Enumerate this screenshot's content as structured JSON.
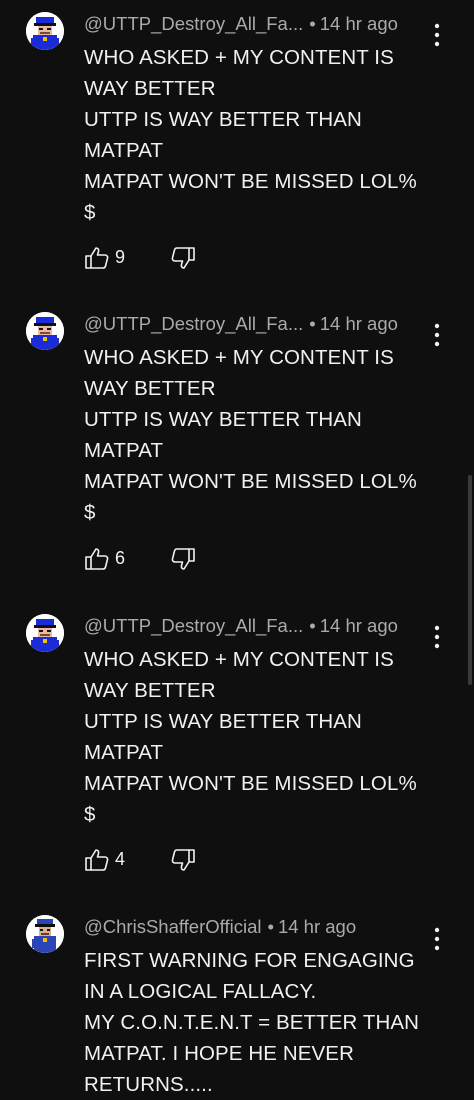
{
  "comments": [
    {
      "handle": "@UTTP_Destroy_All_Fa...",
      "time": "14 hr ago",
      "lines": [
        "WHO ASKED + MY CONTENT IS",
        "WAY BETTER",
        "UTTP IS WAY BETTER THAN",
        "MATPAT",
        "MATPAT WON'T BE MISSED LOL%",
        "$"
      ],
      "likes": "9"
    },
    {
      "handle": "@UTTP_Destroy_All_Fa...",
      "time": "14 hr ago",
      "lines": [
        "WHO ASKED + MY CONTENT IS",
        "WAY BETTER",
        "UTTP IS WAY BETTER THAN",
        "MATPAT",
        "MATPAT WON'T BE MISSED LOL%",
        "$"
      ],
      "likes": "6"
    },
    {
      "handle": "@UTTP_Destroy_All_Fa...",
      "time": "14 hr ago",
      "lines": [
        "WHO ASKED + MY CONTENT IS",
        "WAY BETTER",
        "UTTP IS WAY BETTER THAN",
        "MATPAT",
        "MATPAT WON'T BE MISSED LOL%",
        "$"
      ],
      "likes": "4"
    },
    {
      "handle": "@ChrisShafferOfficial",
      "time": "14 hr ago",
      "lines": [
        "FIRST WARNING FOR ENGAGING",
        "IN A LOGICAL FALLACY.",
        "MY C.O.N.T.E.N.T = BETTER THAN",
        "MATPAT. I HOPE HE NEVER",
        "RETURNS....."
      ]
    }
  ],
  "icons": {
    "like": "thumbs-up-icon",
    "dislike": "thumbs-down-icon",
    "menu": "more-vert-icon"
  },
  "colors": {
    "background": "#0f0f0f",
    "text_primary": "#f1f1f1",
    "text_secondary": "#aaaaaa"
  }
}
